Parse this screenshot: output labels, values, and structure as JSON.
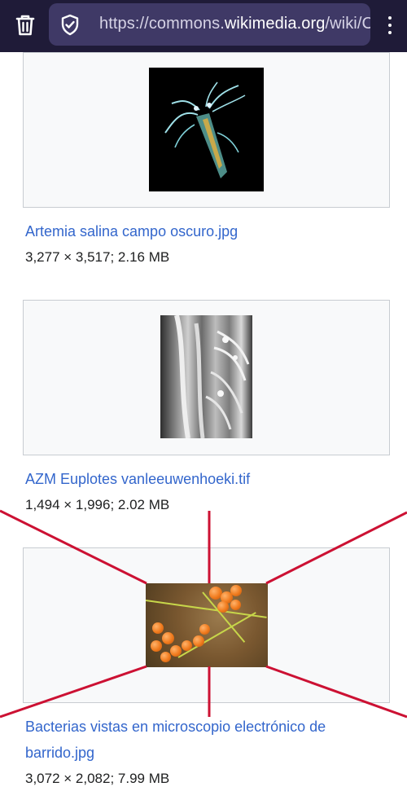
{
  "browser": {
    "url_prefix": "https://commons.",
    "url_domain": "wikimedia.org",
    "url_suffix": "/wiki/C"
  },
  "files": [
    {
      "name": "Artemia salina campo oscuro.jpg",
      "meta": "3,277 × 3,517; 2.16 MB"
    },
    {
      "name": "AZM Euplotes vanleeuwenhoeki.tif",
      "meta": "1,494 × 1,996; 2.02 MB"
    },
    {
      "name": "Bacterias vistas en microscopio electrónico de barrido.jpg",
      "meta": "3,072 × 2,082; 7.99 MB"
    }
  ],
  "colors": {
    "toolbar_bg": "#1f1b38",
    "url_bar_bg": "#3f3966",
    "link": "#3366cc",
    "annotation": "#cc1133"
  }
}
